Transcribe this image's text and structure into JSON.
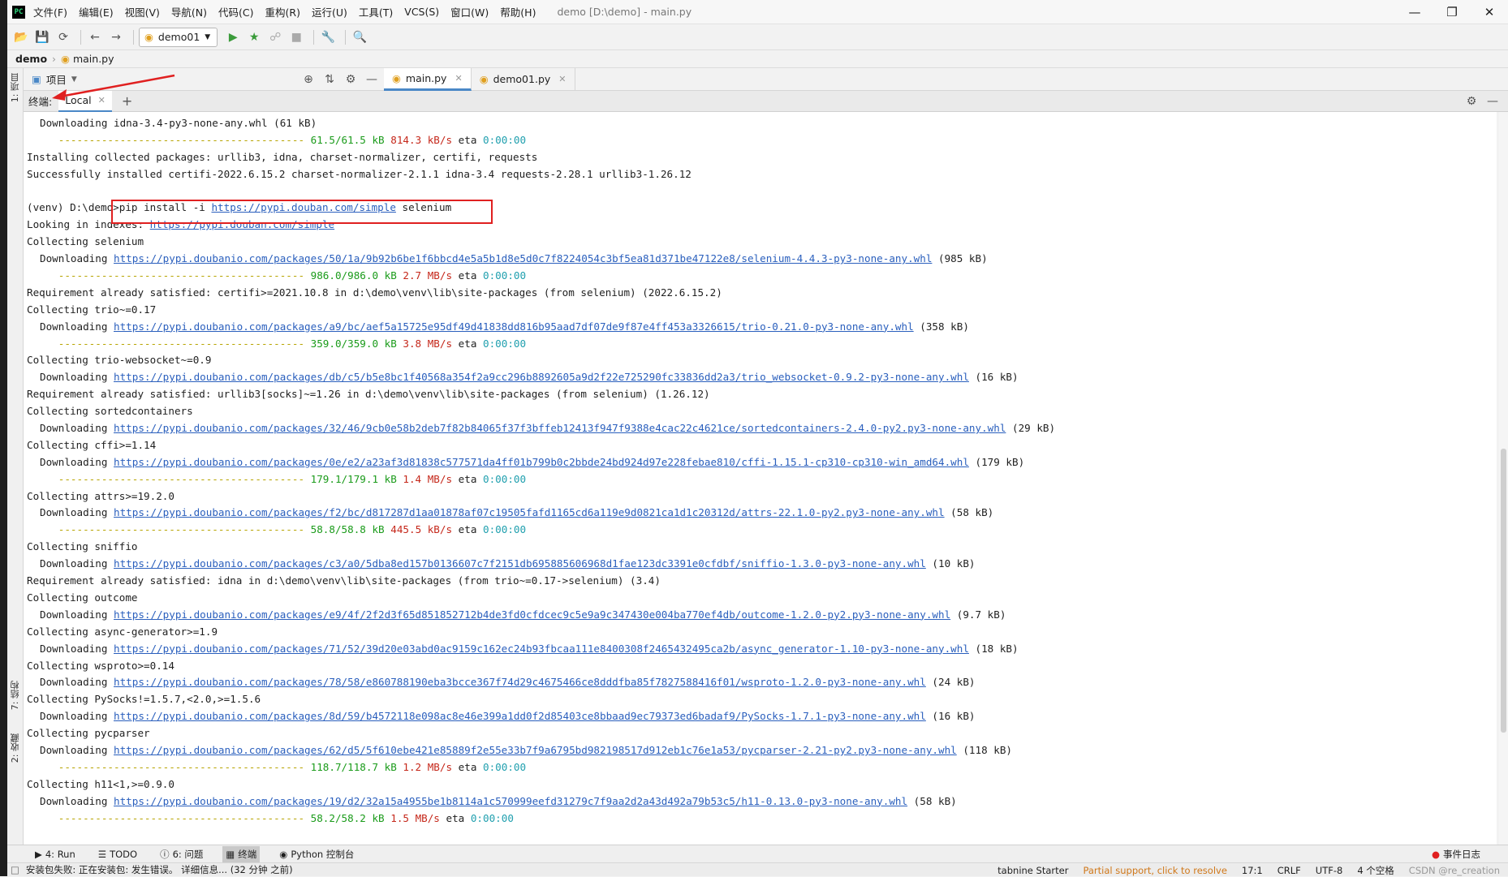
{
  "menubar": {
    "logo": "PC",
    "items": [
      "文件(F)",
      "编辑(E)",
      "视图(V)",
      "导航(N)",
      "代码(C)",
      "重构(R)",
      "运行(U)",
      "工具(T)",
      "VCS(S)",
      "窗口(W)",
      "帮助(H)"
    ],
    "window_title": "demo [D:\\demo] - main.py"
  },
  "toolbar": {
    "run_config": "demo01"
  },
  "breadcrumb": {
    "project": "demo",
    "file": "main.py"
  },
  "left_stripe": {
    "project": "1: 项目",
    "structure": "7: 结构",
    "favorites": "2: 收藏"
  },
  "tabs_bar": {
    "project_selector": "项目",
    "tabs": [
      {
        "label": "main.py"
      },
      {
        "label": "demo01.py"
      }
    ]
  },
  "terminal_header": {
    "title": "终端:",
    "tab_local": "Local",
    "add": "+"
  },
  "terminal": {
    "lines": [
      {
        "t": "plain",
        "indent": true,
        "text": "Downloading idna-3.4-py3-none-any.whl (61 kB)"
      },
      {
        "t": "progress",
        "done": "61.5/61.5 kB",
        "rate": "814.3 kB/s",
        "eta": "0:00:00"
      },
      {
        "t": "plain",
        "text": "Installing collected packages: urllib3, idna, charset-normalizer, certifi, requests"
      },
      {
        "t": "plain",
        "text": "Successfully installed certifi-2022.6.15.2 charset-normalizer-2.1.1 idna-3.4 requests-2.28.1 urllib3-1.26.12"
      },
      {
        "t": "plain",
        "text": ""
      },
      {
        "t": "cmd",
        "prompt": "(venv) D:\\demo>",
        "pre": "pip install -i ",
        "link": "https://pypi.douban.com/simple",
        "post": " selenium"
      },
      {
        "t": "looking",
        "pre": "Looking in indexes: ",
        "link": "https://pypi.douban.com/simple"
      },
      {
        "t": "plain",
        "text": "Collecting selenium"
      },
      {
        "t": "dl",
        "link": "https://pypi.doubanio.com/packages/50/1a/9b92b6be1f6bbcd4e5a5b1d8e5d0c7f8224054c3bf5ea81d371be47122e8/selenium-4.4.3-py3-none-any.whl",
        "size": " (985 kB)"
      },
      {
        "t": "progress",
        "done": "986.0/986.0 kB",
        "rate": "2.7 MB/s",
        "eta": "0:00:00"
      },
      {
        "t": "plain",
        "text": "Requirement already satisfied: certifi>=2021.10.8 in d:\\demo\\venv\\lib\\site-packages (from selenium) (2022.6.15.2)"
      },
      {
        "t": "plain",
        "text": "Collecting trio~=0.17"
      },
      {
        "t": "dl",
        "link": "https://pypi.doubanio.com/packages/a9/bc/aef5a15725e95df49d41838dd816b95aad7df07de9f87e4ff453a3326615/trio-0.21.0-py3-none-any.whl",
        "size": " (358 kB)"
      },
      {
        "t": "progress",
        "done": "359.0/359.0 kB",
        "rate": "3.8 MB/s",
        "eta": "0:00:00"
      },
      {
        "t": "plain",
        "text": "Collecting trio-websocket~=0.9"
      },
      {
        "t": "dl",
        "link": "https://pypi.doubanio.com/packages/db/c5/b5e8bc1f40568a354f2a9cc296b8892605a9d2f22e725290fc33836dd2a3/trio_websocket-0.9.2-py3-none-any.whl",
        "size": " (16 kB)"
      },
      {
        "t": "plain",
        "text": "Requirement already satisfied: urllib3[socks]~=1.26 in d:\\demo\\venv\\lib\\site-packages (from selenium) (1.26.12)"
      },
      {
        "t": "plain",
        "text": "Collecting sortedcontainers"
      },
      {
        "t": "dl",
        "link": "https://pypi.doubanio.com/packages/32/46/9cb0e58b2deb7f82b84065f37f3bffeb12413f947f9388e4cac22c4621ce/sortedcontainers-2.4.0-py2.py3-none-any.whl",
        "size": " (29 kB)"
      },
      {
        "t": "plain",
        "text": "Collecting cffi>=1.14"
      },
      {
        "t": "dl",
        "link": "https://pypi.doubanio.com/packages/0e/e2/a23af3d81838c577571da4ff01b799b0c2bbde24bd924d97e228febae810/cffi-1.15.1-cp310-cp310-win_amd64.whl",
        "size": " (179 kB)"
      },
      {
        "t": "progress",
        "done": "179.1/179.1 kB",
        "rate": "1.4 MB/s",
        "eta": "0:00:00"
      },
      {
        "t": "plain",
        "text": "Collecting attrs>=19.2.0"
      },
      {
        "t": "dl",
        "link": "https://pypi.doubanio.com/packages/f2/bc/d817287d1aa01878af07c19505fafd1165cd6a119e9d0821ca1d1c20312d/attrs-22.1.0-py2.py3-none-any.whl",
        "size": " (58 kB)"
      },
      {
        "t": "progress",
        "done": "58.8/58.8 kB",
        "rate": "445.5 kB/s",
        "eta": "0:00:00"
      },
      {
        "t": "plain",
        "text": "Collecting sniffio"
      },
      {
        "t": "dl",
        "link": "https://pypi.doubanio.com/packages/c3/a0/5dba8ed157b0136607c7f2151db695885606968d1fae123dc3391e0cfdbf/sniffio-1.3.0-py3-none-any.whl",
        "size": " (10 kB)"
      },
      {
        "t": "plain",
        "text": "Requirement already satisfied: idna in d:\\demo\\venv\\lib\\site-packages (from trio~=0.17->selenium) (3.4)"
      },
      {
        "t": "plain",
        "text": "Collecting outcome"
      },
      {
        "t": "dl",
        "link": "https://pypi.doubanio.com/packages/e9/4f/2f2d3f65d851852712b4de3fd0cfdcec9c5e9a9c347430e004ba770ef4db/outcome-1.2.0-py2.py3-none-any.whl",
        "size": " (9.7 kB)"
      },
      {
        "t": "plain",
        "text": "Collecting async-generator>=1.9"
      },
      {
        "t": "dl",
        "link": "https://pypi.doubanio.com/packages/71/52/39d20e03abd0ac9159c162ec24b93fbcaa111e8400308f2465432495ca2b/async_generator-1.10-py3-none-any.whl",
        "size": " (18 kB)"
      },
      {
        "t": "plain",
        "text": "Collecting wsproto>=0.14"
      },
      {
        "t": "dl",
        "link": "https://pypi.doubanio.com/packages/78/58/e860788190eba3bcce367f74d29c4675466ce8dddfba85f7827588416f01/wsproto-1.2.0-py3-none-any.whl",
        "size": " (24 kB)"
      },
      {
        "t": "plain",
        "text": "Collecting PySocks!=1.5.7,<2.0,>=1.5.6"
      },
      {
        "t": "dl",
        "link": "https://pypi.doubanio.com/packages/8d/59/b4572118e098ac8e46e399a1dd0f2d85403ce8bbaad9ec79373ed6badaf9/PySocks-1.7.1-py3-none-any.whl",
        "size": " (16 kB)"
      },
      {
        "t": "plain",
        "text": "Collecting pycparser"
      },
      {
        "t": "dl",
        "link": "https://pypi.doubanio.com/packages/62/d5/5f610ebe421e85889f2e55e33b7f9a6795bd982198517d912eb1c76e1a53/pycparser-2.21-py2.py3-none-any.whl",
        "size": " (118 kB)"
      },
      {
        "t": "progress",
        "done": "118.7/118.7 kB",
        "rate": "1.2 MB/s",
        "eta": "0:00:00"
      },
      {
        "t": "plain",
        "text": "Collecting h11<1,>=0.9.0"
      },
      {
        "t": "dl",
        "link": "https://pypi.doubanio.com/packages/19/d2/32a15a4955be1b8114a1c570999eefd31279c7f9aa2d2a43d492a79b53c5/h11-0.13.0-py3-none-any.whl",
        "size": " (58 kB)"
      },
      {
        "t": "progress",
        "done": "58.2/58.2 kB",
        "rate": "1.5 MB/s",
        "eta": "0:00:00"
      }
    ],
    "dashes": "----------------------------------------",
    "eta_label": "eta",
    "downloading_label": "Downloading "
  },
  "bottom_tools": [
    {
      "label": "4: Run"
    },
    {
      "label": "TODO"
    },
    {
      "label": "6: 问题"
    },
    {
      "label": "终端"
    },
    {
      "label": "Python 控制台"
    }
  ],
  "event_log": "事件日志",
  "statusbar": {
    "message": "安装包失败: 正在安装包: 发生错误。 详细信息... (32 分钟 之前)",
    "tabnine": "tabnine Starter",
    "partial": "Partial support, click to resolve",
    "position": "17:1",
    "line_sep": "CRLF",
    "encoding": "UTF-8",
    "indent": "4 个空格",
    "watermark": "CSDN @re_creation"
  },
  "colors": {
    "accent": "#4a88c7",
    "link": "#2a5fbd",
    "highlight": "#e02020"
  }
}
